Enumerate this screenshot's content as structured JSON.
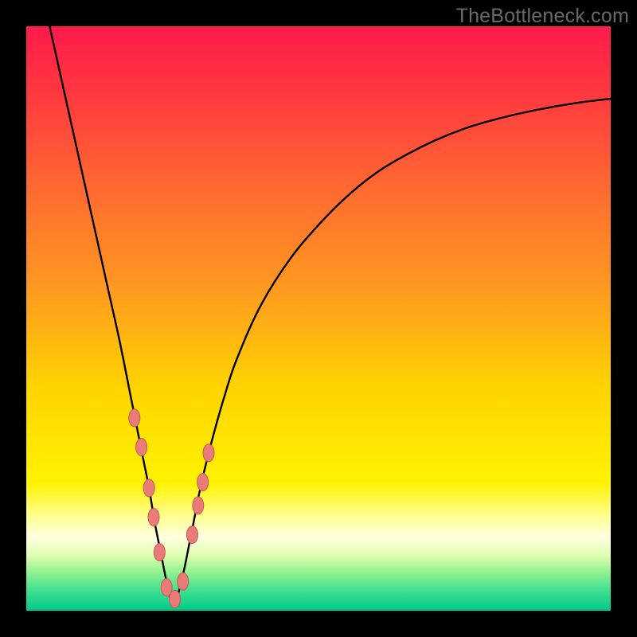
{
  "watermark": "TheBottleneck.com",
  "colors": {
    "frame": "#000000",
    "curve_stroke": "#000000",
    "marker_fill": "#e97b78",
    "marker_stroke": "#c85a57",
    "gradient_stops": [
      {
        "offset": 0.0,
        "color": "#ff1a4b"
      },
      {
        "offset": 0.12,
        "color": "#ff3a3f"
      },
      {
        "offset": 0.28,
        "color": "#ff6a30"
      },
      {
        "offset": 0.45,
        "color": "#ff9a20"
      },
      {
        "offset": 0.62,
        "color": "#ffd400"
      },
      {
        "offset": 0.78,
        "color": "#fff200"
      },
      {
        "offset": 0.845,
        "color": "#ffffa0"
      },
      {
        "offset": 0.875,
        "color": "#ffffe0"
      },
      {
        "offset": 0.905,
        "color": "#dfffb0"
      },
      {
        "offset": 0.935,
        "color": "#90f090"
      },
      {
        "offset": 0.965,
        "color": "#40e090"
      },
      {
        "offset": 1.0,
        "color": "#00c98a"
      }
    ]
  },
  "chart_data": {
    "type": "line",
    "title": "",
    "xlabel": "",
    "ylabel": "",
    "xlim": [
      0,
      100
    ],
    "ylim": [
      0,
      100
    ],
    "grid": false,
    "legend": null,
    "x_of_min": 25,
    "series": [
      {
        "name": "bottleneck-curve",
        "x": [
          4,
          6,
          8,
          10,
          12,
          14,
          16,
          18,
          19,
          20,
          21,
          22,
          23,
          24,
          25,
          26,
          27,
          28,
          29,
          30,
          32,
          34,
          36,
          40,
          45,
          50,
          55,
          60,
          65,
          70,
          75,
          80,
          85,
          90,
          95,
          100
        ],
        "y": [
          100,
          91,
          82,
          73,
          64,
          55,
          46,
          36,
          31,
          26,
          21,
          15,
          10,
          5,
          1,
          3,
          7,
          12,
          17,
          22,
          30,
          37,
          43,
          52,
          60,
          66,
          71,
          75,
          78,
          80.5,
          82.5,
          84,
          85.2,
          86.2,
          87,
          87.6
        ]
      }
    ],
    "markers": {
      "name": "highlight-points",
      "x": [
        18.5,
        19.7,
        21.0,
        21.8,
        22.8,
        24.0,
        25.4,
        26.8,
        28.4,
        29.4,
        30.2,
        31.2
      ],
      "y": [
        33,
        28,
        21,
        16,
        10,
        4,
        2,
        5,
        13,
        18,
        22,
        27
      ]
    }
  }
}
